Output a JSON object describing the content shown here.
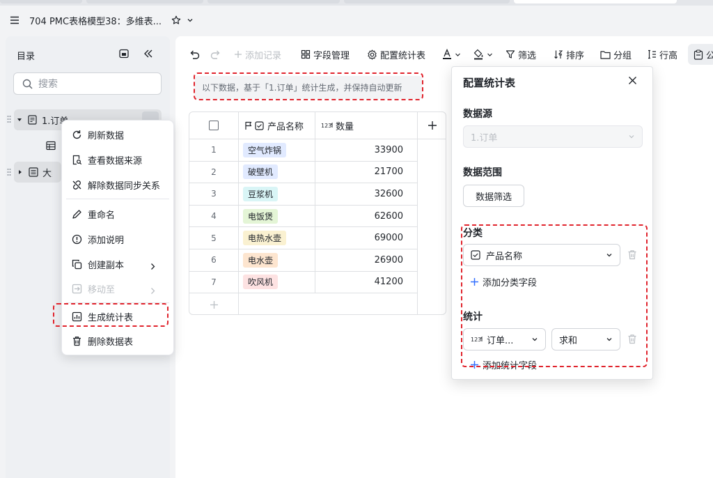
{
  "window": {
    "title": "704 PMC表格模型38：多维表..."
  },
  "sidebar": {
    "title": "目录",
    "search_placeholder": "搜索",
    "items": [
      {
        "label": "1.订单"
      },
      {
        "label": "大类"
      }
    ]
  },
  "context_menu": {
    "items": [
      {
        "label": "刷新数据"
      },
      {
        "label": "查看数据来源"
      },
      {
        "label": "解除数据同步关系"
      },
      {
        "label": "重命名"
      },
      {
        "label": "添加说明"
      },
      {
        "label": "创建副本"
      },
      {
        "label": "移动至"
      },
      {
        "label": "生成统计表"
      },
      {
        "label": "删除数据表"
      }
    ]
  },
  "toolbar": {
    "add_record": "添加记录",
    "field_manage": "字段管理",
    "config_stats": "配置统计表",
    "filter": "筛选",
    "sort": "排序",
    "group": "分组",
    "row_height": "行高",
    "share_partial": "公"
  },
  "notice": "以下数据，基于「1.订单」统计生成，并保持自动更新",
  "table": {
    "columns": [
      {
        "label": "产品名称"
      },
      {
        "label": "数量"
      }
    ],
    "rows": [
      {
        "index": "1",
        "product": "空气炸锅",
        "qty": "33900",
        "tag_color": "#e1eaff"
      },
      {
        "index": "2",
        "product": "破壁机",
        "qty": "21700",
        "tag_color": "#e1eaff"
      },
      {
        "index": "3",
        "product": "豆浆机",
        "qty": "32600",
        "tag_color": "#d9f5f6"
      },
      {
        "index": "4",
        "product": "电饭煲",
        "qty": "62600",
        "tag_color": "#e4f5d6"
      },
      {
        "index": "5",
        "product": "电热水壶",
        "qty": "69000",
        "tag_color": "#faf1d1"
      },
      {
        "index": "6",
        "product": "电水壶",
        "qty": "26900",
        "tag_color": "#fde5cf"
      },
      {
        "index": "7",
        "product": "吹风机",
        "qty": "41200",
        "tag_color": "#fde2e2"
      }
    ]
  },
  "config_panel": {
    "title": "配置统计表",
    "datasource_label": "数据源",
    "datasource_value": "1.订单",
    "range_label": "数据范围",
    "range_button": "数据筛选",
    "category_label": "分类",
    "category_field": "产品名称",
    "add_category": "添加分类字段",
    "stats_label": "统计",
    "stats_field": "订单...",
    "stats_agg": "求和",
    "add_stats": "添加统计字段"
  },
  "colors": {
    "highlight": "#e0232c",
    "accent": "#3370ff"
  }
}
